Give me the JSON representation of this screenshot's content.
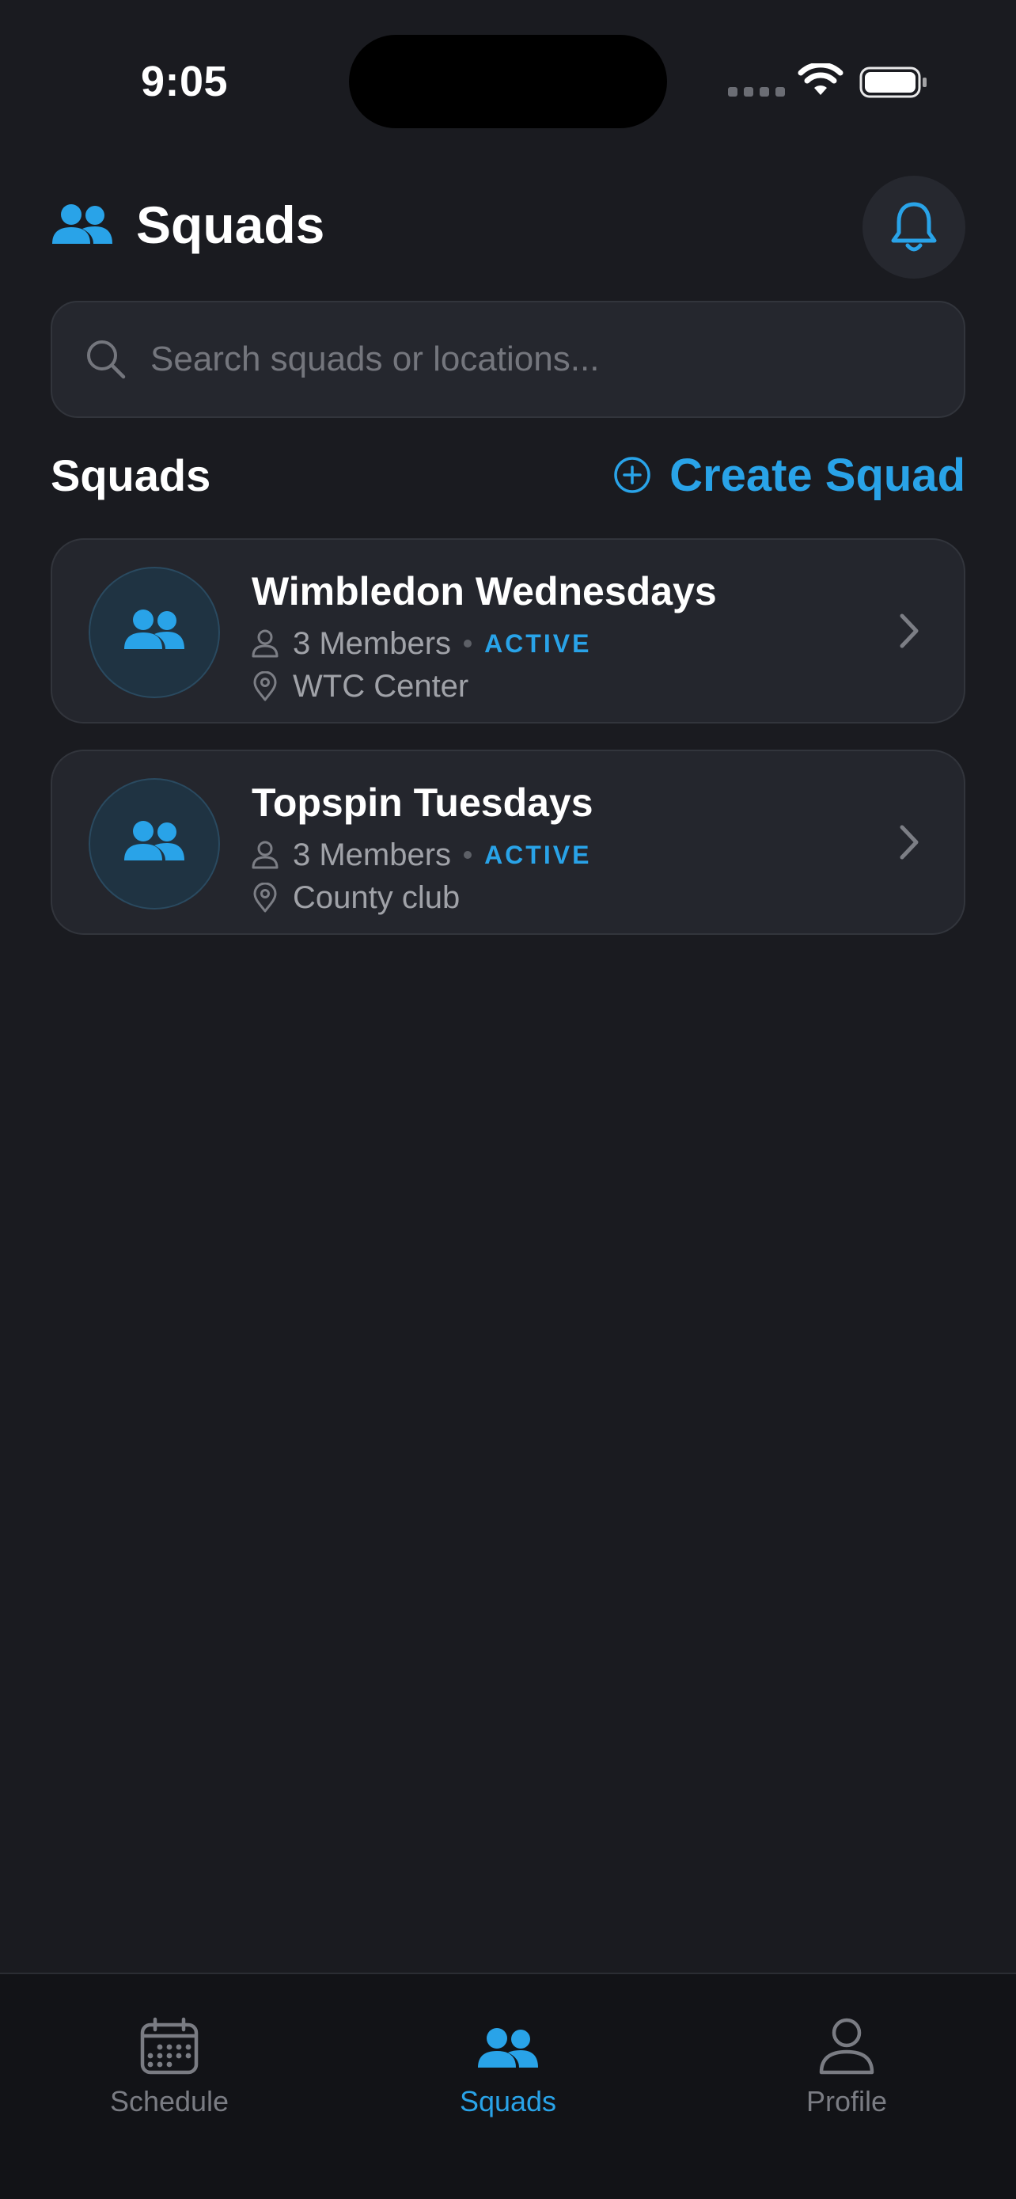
{
  "status_bar": {
    "time": "9:05"
  },
  "header": {
    "title": "Squads"
  },
  "search": {
    "placeholder": "Search squads or locations..."
  },
  "section": {
    "title": "Squads",
    "create_label": "Create Squad"
  },
  "squads": [
    {
      "name": "Wimbledon Wednesdays",
      "members": "3 Members",
      "status": "ACTIVE",
      "location": "WTC Center"
    },
    {
      "name": "Topspin Tuesdays",
      "members": "3 Members",
      "status": "ACTIVE",
      "location": "County club"
    }
  ],
  "tab_bar": {
    "tabs": [
      {
        "label": "Schedule",
        "icon": "calendar-icon",
        "active": false
      },
      {
        "label": "Squads",
        "icon": "people-icon",
        "active": true
      },
      {
        "label": "Profile",
        "icon": "person-icon",
        "active": false
      }
    ]
  },
  "colors": {
    "background": "#1a1b20",
    "card": "#24262d",
    "accent": "#29a3e8",
    "muted_text": "#a0a2a8",
    "tab_bar": "#121317"
  }
}
